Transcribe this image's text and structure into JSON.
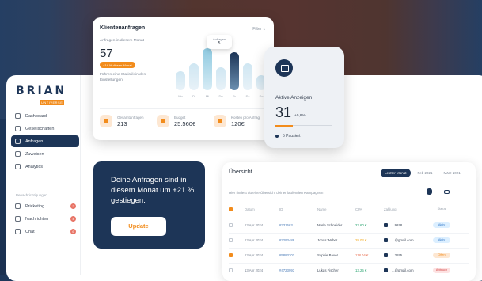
{
  "brand": {
    "name": "BRIAN",
    "tag": "UNTIVERSE"
  },
  "sidebar": {
    "items": [
      {
        "label": "Dashboard",
        "active": false
      },
      {
        "label": "Gesellschaften",
        "active": false
      },
      {
        "label": "Anfragen",
        "active": true
      },
      {
        "label": "Zuweisen",
        "active": false
      },
      {
        "label": "Analytics",
        "active": false
      }
    ],
    "section_label": "Benachrichtigungen",
    "messages": [
      {
        "label": "Pricketing",
        "badge": "2"
      },
      {
        "label": "Nachrichten",
        "badge": "4"
      },
      {
        "label": "Chat",
        "badge": "6"
      }
    ]
  },
  "stats_card": {
    "title": "Klientenanfragen",
    "filter": "Filter",
    "subtitle": "Anfragen in diesem Monat",
    "value": "57",
    "pill": "+14 % diesen Monat",
    "description": "Führen eine Statistik in den Einstellungen",
    "tooltip_label": "Anfragen",
    "tooltip_value": "5",
    "kpis": [
      {
        "label": "Gesamtanfragen",
        "value": "213"
      },
      {
        "label": "Budget",
        "value": "25.560€"
      },
      {
        "label": "Kosten pro Anfrag",
        "value": "120€"
      }
    ]
  },
  "chart_data": {
    "type": "bar",
    "categories": [
      "Mo",
      "Di",
      "Mi",
      "Do",
      "Fr",
      "Sa",
      "So"
    ],
    "values": [
      2.5,
      3.5,
      5.5,
      3,
      5,
      3.5,
      2
    ],
    "highlighted": "Fr",
    "xlabel": "",
    "ylabel": ""
  },
  "ads_card": {
    "title": "Aktive Anzeigen",
    "value": "31",
    "delta": "+0,8%",
    "paused": "5 Pausiert"
  },
  "promo": {
    "text": "Deine Anfragen sind in diesem Monat um +21 % gestiegen.",
    "button": "Update"
  },
  "table": {
    "title": "Übersicht",
    "tabs": [
      {
        "label": "Letzter Monat",
        "active": true
      },
      {
        "label": "Feb 2021",
        "active": false
      },
      {
        "label": "März 2021",
        "active": false
      }
    ],
    "subtitle": "Hier findest du eine Übersicht deiner laufenden Kampagnen",
    "headers": [
      "Datum",
      "ID",
      "Name",
      "CPA",
      "Zahlung",
      "Status"
    ],
    "rows": [
      {
        "date": "13 Apr 2024",
        "id": "#331663",
        "name": "Marie Schneider",
        "cpa": "23.60 €",
        "cpa_color": "#22a06b",
        "pay": "...9978",
        "status": "Aktiv",
        "status_bg": "#dcefff",
        "status_fg": "#2f76c8",
        "checked": false
      },
      {
        "date": "13 Apr 2024",
        "id": "#2293488",
        "name": "Jonas Weber",
        "cpa": "28.03 €",
        "cpa_color": "#f2a91c",
        "pay": "...@gmail.com",
        "status": "Aktiv",
        "status_bg": "#dcefff",
        "status_fg": "#2f76c8",
        "checked": false
      },
      {
        "date": "13 Apr 2024",
        "id": "#5883201",
        "name": "Sophie Bauer",
        "cpa": "118.04 €",
        "cpa_color": "#e86a4b",
        "pay": "...3195",
        "status": "Offen",
        "status_bg": "#fde7d2",
        "status_fg": "#f28c1c",
        "checked": true
      },
      {
        "date": "13 Apr 2024",
        "id": "#4723993",
        "name": "Lukas Fischer",
        "cpa": "13.25 €",
        "cpa_color": "#22a06b",
        "pay": "...@gmail.com",
        "status": "Abbruch",
        "status_bg": "#fde2e2",
        "status_fg": "#d14343",
        "checked": false
      }
    ]
  }
}
